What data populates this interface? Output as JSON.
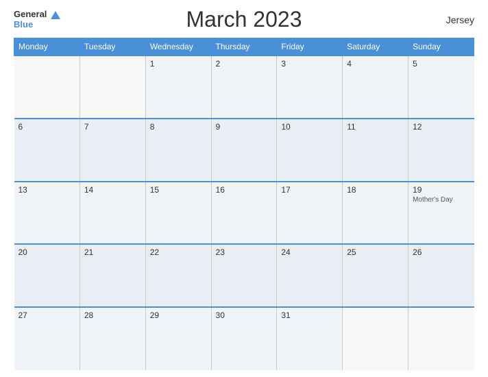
{
  "header": {
    "logo_general": "General",
    "logo_blue": "Blue",
    "title": "March 2023",
    "region": "Jersey"
  },
  "weekdays": [
    "Monday",
    "Tuesday",
    "Wednesday",
    "Thursday",
    "Friday",
    "Saturday",
    "Sunday"
  ],
  "weeks": [
    [
      {
        "day": "",
        "empty": true
      },
      {
        "day": "",
        "empty": true
      },
      {
        "day": "1",
        "empty": false
      },
      {
        "day": "2",
        "empty": false
      },
      {
        "day": "3",
        "empty": false
      },
      {
        "day": "4",
        "empty": false
      },
      {
        "day": "5",
        "empty": false
      }
    ],
    [
      {
        "day": "6",
        "empty": false
      },
      {
        "day": "7",
        "empty": false
      },
      {
        "day": "8",
        "empty": false
      },
      {
        "day": "9",
        "empty": false
      },
      {
        "day": "10",
        "empty": false
      },
      {
        "day": "11",
        "empty": false
      },
      {
        "day": "12",
        "empty": false
      }
    ],
    [
      {
        "day": "13",
        "empty": false
      },
      {
        "day": "14",
        "empty": false
      },
      {
        "day": "15",
        "empty": false
      },
      {
        "day": "16",
        "empty": false
      },
      {
        "day": "17",
        "empty": false
      },
      {
        "day": "18",
        "empty": false
      },
      {
        "day": "19",
        "empty": false,
        "event": "Mother's Day"
      }
    ],
    [
      {
        "day": "20",
        "empty": false
      },
      {
        "day": "21",
        "empty": false
      },
      {
        "day": "22",
        "empty": false
      },
      {
        "day": "23",
        "empty": false
      },
      {
        "day": "24",
        "empty": false
      },
      {
        "day": "25",
        "empty": false
      },
      {
        "day": "26",
        "empty": false
      }
    ],
    [
      {
        "day": "27",
        "empty": false
      },
      {
        "day": "28",
        "empty": false
      },
      {
        "day": "29",
        "empty": false
      },
      {
        "day": "30",
        "empty": false
      },
      {
        "day": "31",
        "empty": false
      },
      {
        "day": "",
        "empty": true
      },
      {
        "day": "",
        "empty": true
      }
    ]
  ]
}
